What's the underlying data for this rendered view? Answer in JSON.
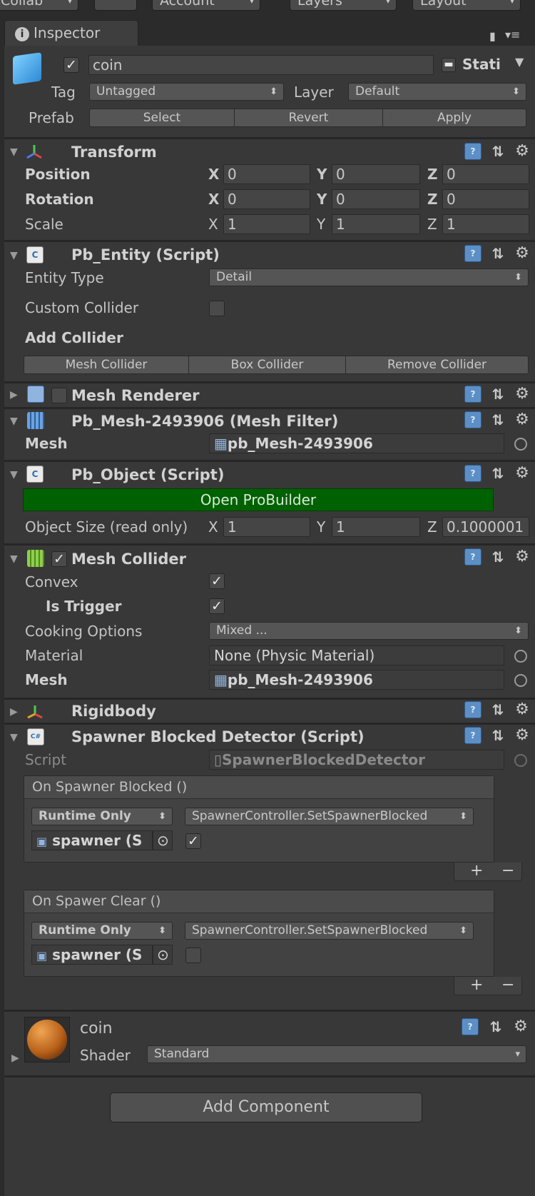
{
  "topbar": {
    "collab": "Collab",
    "account": "Account",
    "layers": "Layers",
    "layout": "Layout",
    "arrow": "▾"
  },
  "tab": {
    "label": "Inspector",
    "info": "i",
    "lock": "🔒",
    "menu": "▾≡"
  },
  "gameobject": {
    "active": "✓",
    "name": "coin",
    "static_label": "Stati",
    "tag_label": "Tag",
    "tag_value": "Untagged",
    "layer_label": "Layer",
    "layer_value": "Default",
    "prefab_label": "Prefab",
    "prefab_select": "Select",
    "prefab_revert": "Revert",
    "prefab_apply": "Apply"
  },
  "transform": {
    "title": "Transform",
    "position_label": "Position",
    "rotation_label": "Rotation",
    "scale_label": "Scale",
    "x": "X",
    "y": "Y",
    "z": "Z",
    "position": [
      "0",
      "0",
      "0"
    ],
    "rotation": [
      "0",
      "0",
      "0"
    ],
    "scale": [
      "1",
      "1",
      "1"
    ]
  },
  "pb_entity": {
    "title": "Pb_Entity (Script)",
    "entity_type_label": "Entity Type",
    "entity_type_value": "Detail",
    "custom_collider_label": "Custom Collider",
    "add_collider_label": "Add Collider",
    "mesh_collider_btn": "Mesh Collider",
    "box_collider_btn": "Box Collider",
    "remove_collider_btn": "Remove Collider"
  },
  "mesh_renderer": {
    "title": "Mesh Renderer"
  },
  "mesh_filter": {
    "title": "Pb_Mesh-2493906 (Mesh Filter)",
    "mesh_label": "Mesh",
    "mesh_value": "pb_Mesh-2493906"
  },
  "pb_object": {
    "title": "Pb_Object (Script)",
    "open_btn": "Open ProBuilder",
    "size_label": "Object Size (read only)",
    "size": [
      "1",
      "1",
      "0.1000001"
    ]
  },
  "mesh_collider": {
    "title": "Mesh Collider",
    "convex_label": "Convex",
    "trigger_label": "Is Trigger",
    "cooking_label": "Cooking Options",
    "cooking_value": "Mixed ...",
    "material_label": "Material",
    "material_value": "None (Physic Material)",
    "mesh_label": "Mesh",
    "mesh_value": "pb_Mesh-2493906",
    "check": "✓"
  },
  "rigidbody": {
    "title": "Rigidbody"
  },
  "spawner": {
    "title": "Spawner Blocked Detector (Script)",
    "script_label": "Script",
    "script_value": "SpawnerBlockedDetector",
    "event1": {
      "title": "On Spawner Blocked ()",
      "mode": "Runtime Only",
      "function": "SpawnerController.SetSpawnerBlocked",
      "target": "spawner (S",
      "arg_checked": "✓"
    },
    "event2": {
      "title": "On Spawer Clear ()",
      "mode": "Runtime Only",
      "function": "SpawnerController.SetSpawnerBlocked",
      "target": "spawner (S",
      "arg_checked": ""
    },
    "plus": "+",
    "minus": "−"
  },
  "material": {
    "name": "coin",
    "shader_label": "Shader",
    "shader_value": "Standard"
  },
  "add_component": "Add Component",
  "icons": {
    "help": "?",
    "settings": "⇅",
    "gear": "⚙",
    "fold_open": "▼",
    "fold_closed": "▶",
    "dd_arrow": "⬍"
  }
}
